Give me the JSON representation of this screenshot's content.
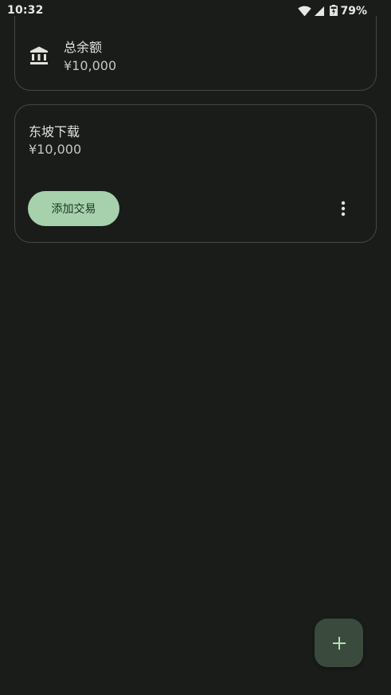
{
  "status_bar": {
    "time": "10:32",
    "battery": "79%",
    "icons": [
      "wifi-icon",
      "signal-icon",
      "battery-charging-icon"
    ]
  },
  "summary_card": {
    "icon": "bank-icon",
    "label": "总余额",
    "amount": "¥10,000"
  },
  "account_card": {
    "name": "东坡下载",
    "balance": "¥10,000",
    "add_transaction_label": "添加交易",
    "more_icon": "more-vert-icon"
  },
  "fab": {
    "icon": "plus-icon"
  },
  "colors": {
    "background": "#1a1c1a",
    "card_border": "#434843",
    "button_fill": "#a7d0ac",
    "button_text": "#173620",
    "fab_fill": "#3a4a3c",
    "fab_icon": "#b6dcba"
  }
}
